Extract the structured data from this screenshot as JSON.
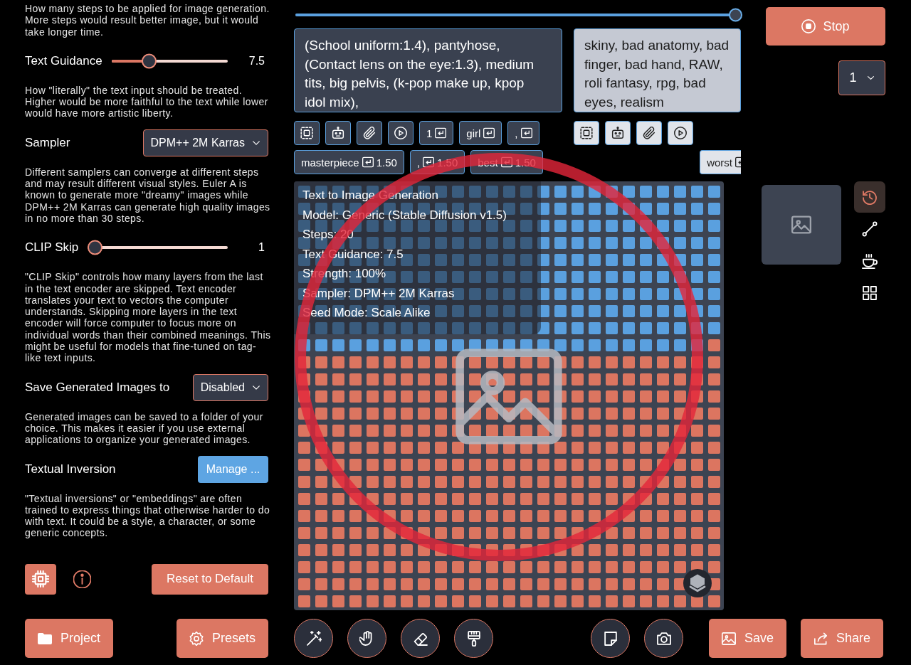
{
  "settings": {
    "intro": "How many steps to be applied for image generation. More steps would result better image, but it would take longer time.",
    "items": [
      {
        "kind": "slider",
        "label": "Text Guidance",
        "level": 0.3,
        "reading": "7.5",
        "description": "How \"literally\" the text input should be treated. Higher would be more faithful to the text while lower would have more artistic liberty."
      },
      {
        "kind": "dropdown",
        "label": "Sampler",
        "value": "DPM++ 2M Karras",
        "description": "Different samplers can converge at different steps and may result different visual styles. Euler A is known to generate more \"dreamy\" images while DPM++ 2M Karras can generate high quality images in no more than 30 steps."
      },
      {
        "kind": "slider",
        "label": "CLIP Skip",
        "level": 0,
        "reading": "1",
        "description": "\"CLIP Skip\" controls how many layers from the last in the text encoder are skipped. Text encoder translates your text to vectors the computer understands. Skipping more layers in the text encoder will force computer to focus more on individual words than their combined meanings. This might be useful for models that fine-tuned on tag-like text inputs."
      },
      {
        "kind": "dropdown",
        "label": "Save Generated Images to",
        "value": "Disabled",
        "description": "Generated images can be saved to a folder of your choice. This makes it easier if you use external applications to organize your generated images."
      },
      {
        "kind": "button",
        "label": "Textual Inversion",
        "button": "Manage ...",
        "description": "\"Textual inversions\" or \"embeddings\" are often trained to express things that otherwise harder to do with text. It could be a style, a character, or some generic concepts."
      }
    ],
    "reset_button": "Reset to Default"
  },
  "top_slider": {
    "level": 1
  },
  "prompt": {
    "text": "(School uniform:1.4), pantyhose, (Contact lens on the eye:1.3), medium tits, big pelvis, (k-pop make up, kpop idol mix),",
    "tools": [
      {
        "kind": "select"
      },
      {
        "kind": "robot"
      },
      {
        "kind": "attach"
      },
      {
        "kind": "play"
      }
    ],
    "tokens": [
      {
        "label": "1"
      },
      {
        "label": "girl"
      },
      {
        "label": ","
      },
      {
        "label": "masterpiece",
        "weight": "1.50"
      },
      {
        "label": ",",
        "weight": "1.50"
      },
      {
        "label": "best",
        "weight": "1.50"
      }
    ]
  },
  "negative_prompt": {
    "text": "skiny, bad anatomy, bad finger, bad hand, RAW, roli fantasy, rpg, bad eyes, realism",
    "tools": [
      {
        "kind": "select"
      },
      {
        "kind": "robot"
      },
      {
        "kind": "attach"
      },
      {
        "kind": "play"
      }
    ],
    "tokens": [
      {
        "label": "worst"
      }
    ]
  },
  "canvas": {
    "info": [
      "Text to Image Generation",
      "Model: Generic (Stable Diffusion v1.5)",
      "Steps: 20",
      "Text Guidance: 7.5",
      "Strength: 100%",
      "Sampler: DPM++ 2M Karras",
      "Seed Mode: Scale Alike"
    ]
  },
  "stop_button": "Stop",
  "batch_count": {
    "value": "1"
  },
  "side_tools": [
    {
      "kind": "history",
      "selected": true
    },
    {
      "kind": "nodes",
      "selected": false
    },
    {
      "kind": "cup",
      "selected": false
    },
    {
      "kind": "grid",
      "selected": false
    }
  ],
  "bottom_bar": {
    "left_buttons": [
      {
        "kind": "folder",
        "label": "Project"
      },
      {
        "kind": "gear",
        "label": "Presets"
      }
    ],
    "edit_tools": [
      {
        "kind": "wand"
      },
      {
        "kind": "hand"
      },
      {
        "kind": "eraser"
      },
      {
        "kind": "brush"
      }
    ],
    "capture_tools": [
      {
        "kind": "note"
      },
      {
        "kind": "camera"
      }
    ],
    "right_buttons": [
      {
        "kind": "image",
        "label": "Save"
      },
      {
        "kind": "share",
        "label": "Share"
      }
    ]
  }
}
